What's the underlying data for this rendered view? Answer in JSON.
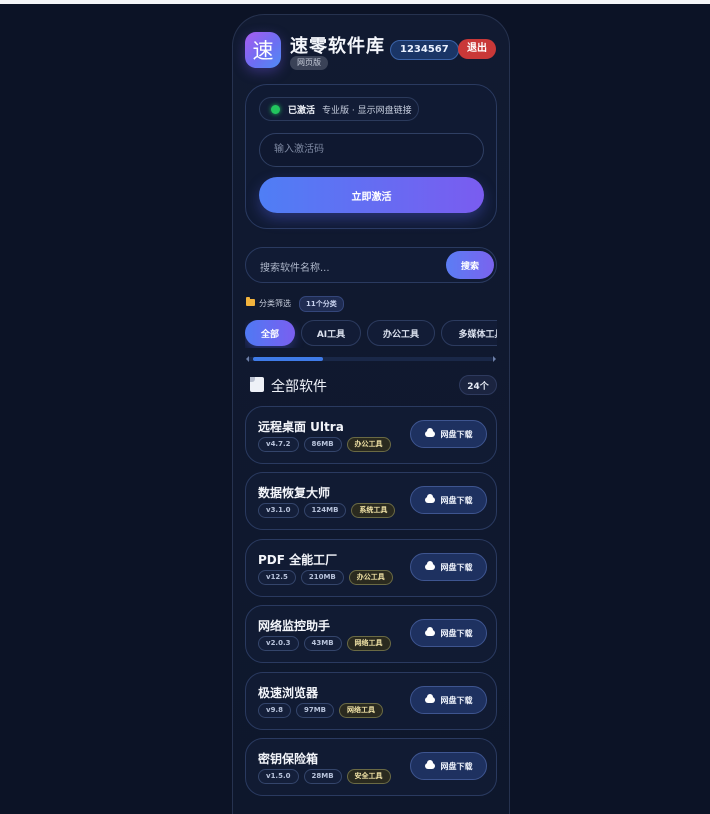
{
  "header": {
    "logo_char": "速",
    "app_title": "速零软件库",
    "web_tag": "网页版",
    "user_id": "1234567",
    "logout_label": "退出"
  },
  "activation": {
    "status_label": "已激活",
    "status_detail": "专业版 · 显示网盘链接",
    "code_placeholder": "输入激活码",
    "activate_label": "立即激活"
  },
  "search": {
    "placeholder": "搜索软件名称...",
    "button_label": "搜索"
  },
  "categories": {
    "label": "分类筛选",
    "count": "11个分类",
    "chips": [
      {
        "label": "全部",
        "active": true
      },
      {
        "label": "AI工具",
        "active": false
      },
      {
        "label": "办公工具",
        "active": false
      },
      {
        "label": "多媒体工具",
        "active": false
      }
    ]
  },
  "list": {
    "title": "全部软件",
    "count": "24个",
    "download_label": "网盘下载",
    "items": [
      {
        "name": "远程桌面 Ultra",
        "version": "v4.7.2",
        "size": "86MB",
        "category": "办公工具"
      },
      {
        "name": "数据恢复大师",
        "version": "v3.1.0",
        "size": "124MB",
        "category": "系统工具"
      },
      {
        "name": "PDF 全能工厂",
        "version": "v12.5",
        "size": "210MB",
        "category": "办公工具"
      },
      {
        "name": "网络监控助手",
        "version": "v2.0.3",
        "size": "43MB",
        "category": "网络工具"
      },
      {
        "name": "极速浏览器",
        "version": "v9.8",
        "size": "97MB",
        "category": "网络工具"
      },
      {
        "name": "密钥保险箱",
        "version": "v1.5.0",
        "size": "28MB",
        "category": "安全工具"
      }
    ]
  },
  "colors": {
    "background": "#0c1326",
    "accent_gradient_start": "#4f7ef5",
    "accent_gradient_end": "#7a5cf0",
    "logout": "#c93838",
    "status_green": "#22c55e"
  }
}
